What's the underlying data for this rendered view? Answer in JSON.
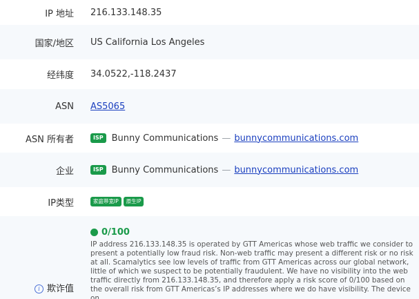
{
  "rows": {
    "ip": {
      "label": "IP 地址",
      "value": "216.133.148.35"
    },
    "region": {
      "label": "国家/地区",
      "value": "US California Los Angeles"
    },
    "coords": {
      "label": "经纬度",
      "value": "34.0522,-118.2437"
    },
    "asn": {
      "label": "ASN",
      "value": "AS5065"
    },
    "asn_owner": {
      "label": "ASN 所有者",
      "tag": "ISP",
      "name": "Bunny Communications",
      "separator": "—",
      "domain": "bunnycommunications.com"
    },
    "company": {
      "label": "企业",
      "tag": "ISP",
      "name": "Bunny Communications",
      "separator": "—",
      "domain": "bunnycommunications.com"
    },
    "ip_type": {
      "label": "IP类型",
      "badges": [
        "家庭带宽IP",
        "原生IP"
      ]
    },
    "fraud": {
      "label": "欺诈值",
      "score": "0/100",
      "description": "IP address 216.133.148.35 is operated by GTT Americas whose web traffic we consider to present a potentially low fraud risk. Non-web traffic may present a different risk or no risk at all. Scamalytics see low levels of traffic from GTT Americas across our global network, little of which we suspect to be potentially fraudulent. We have no visibility into the web traffic directly from 216.133.148.35, and therefore apply a risk score of 0/100 based on the overall risk from GTT Americas’s IP addresses where we do have visibility. The device on"
    }
  },
  "colors": {
    "accent_green": "#1a9a4a",
    "link_blue": "#1a3fbf",
    "row_alt_bg": "#f6f9fc"
  },
  "icons": {
    "info": "info-circle-icon",
    "score_dot": "green-dot-icon"
  }
}
